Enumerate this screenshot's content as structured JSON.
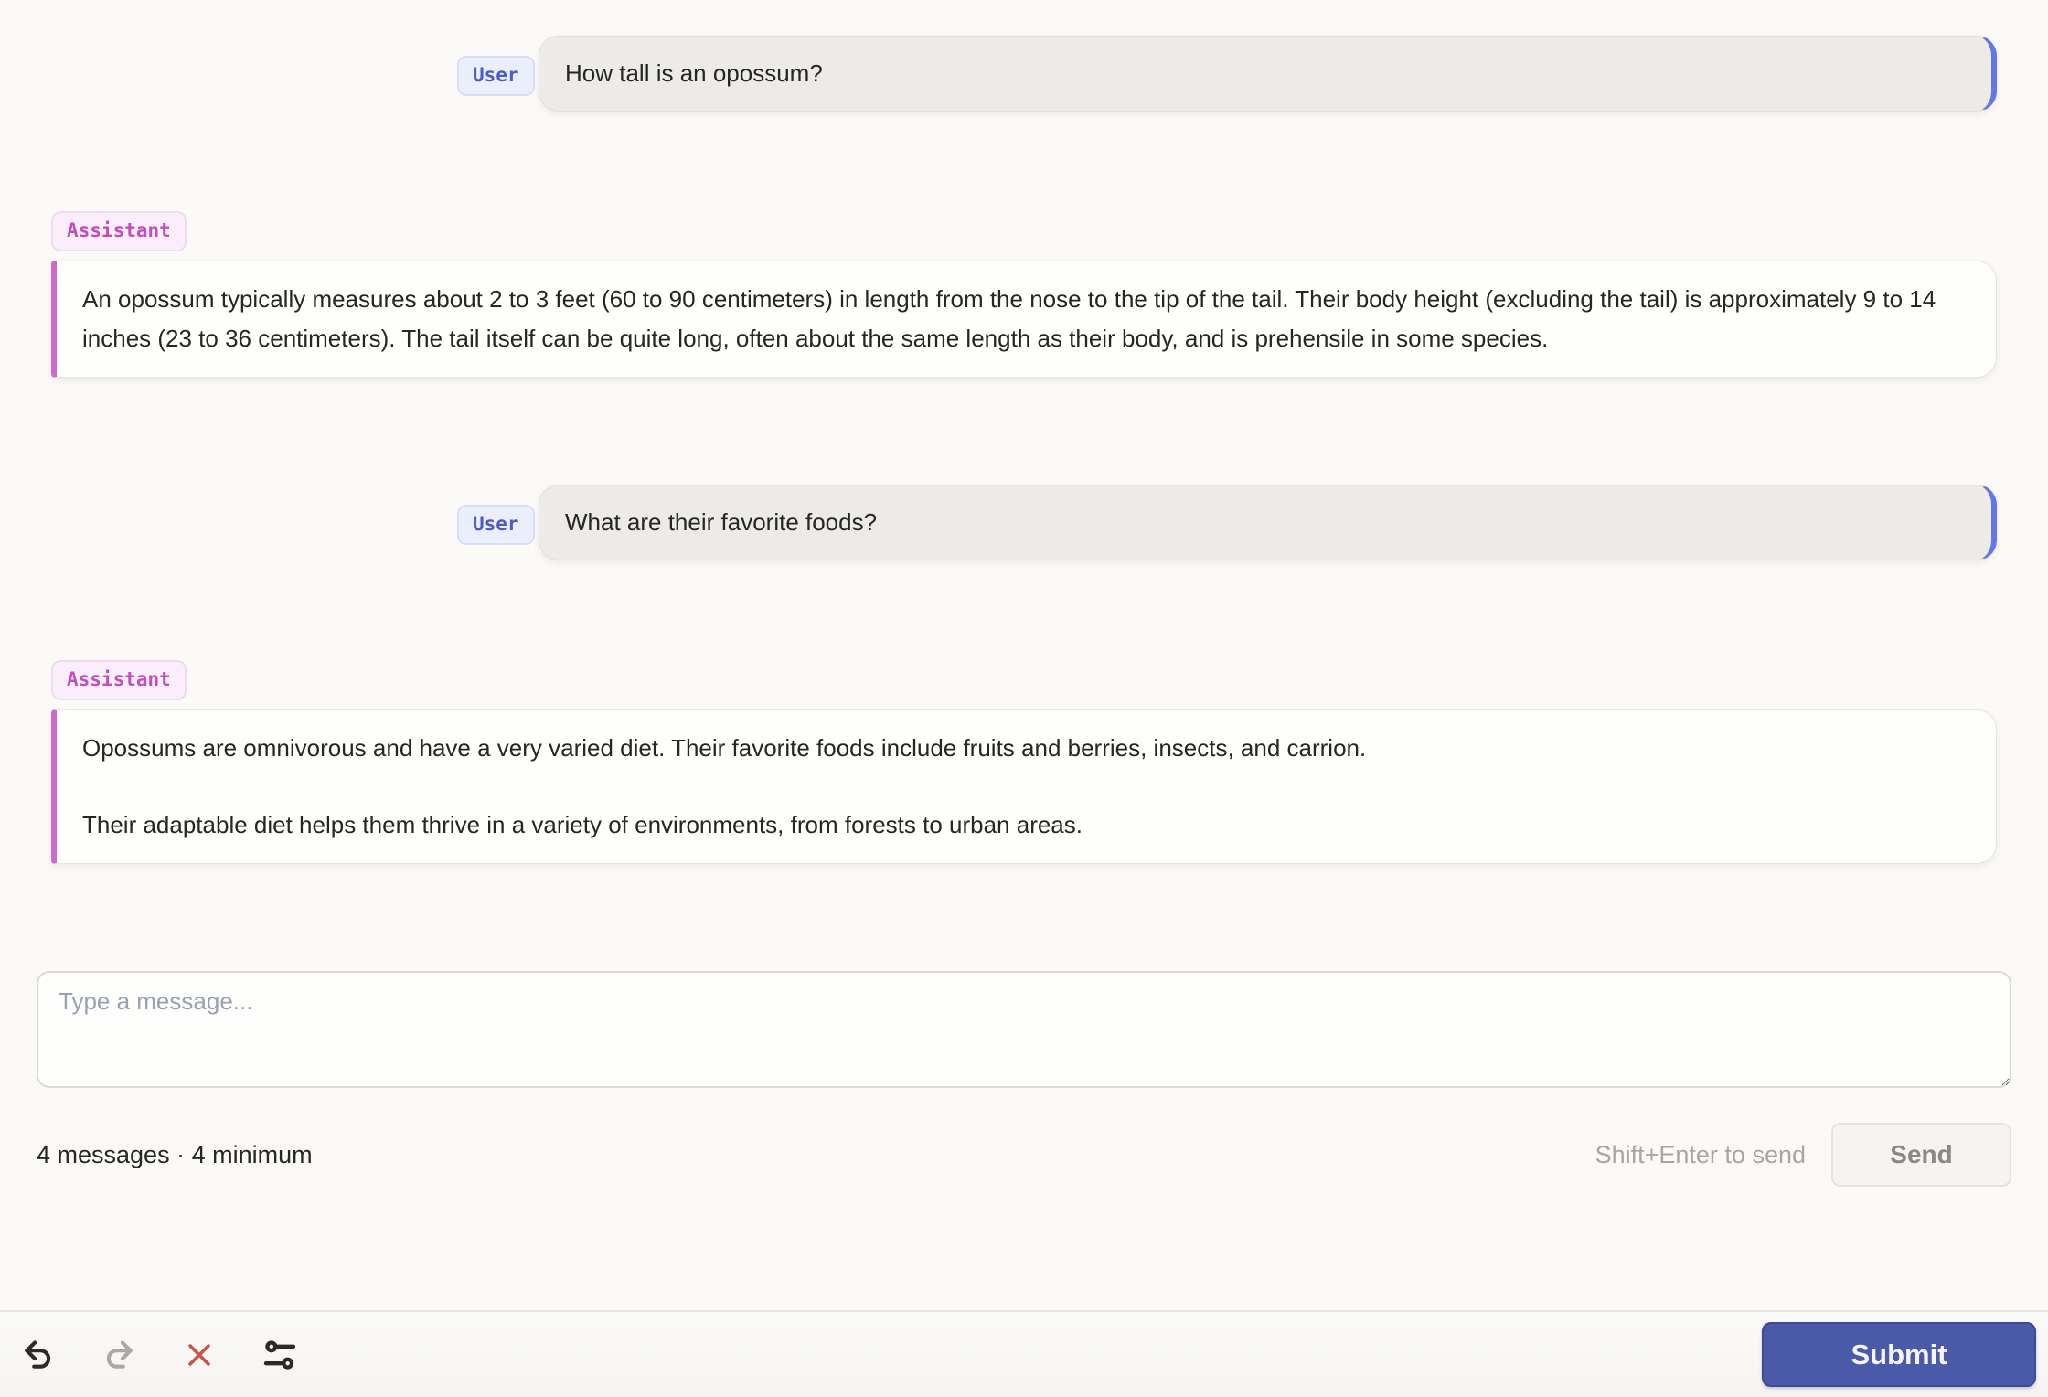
{
  "conversation": {
    "messages": [
      {
        "role_label": "User",
        "text": "How tall is an opossum?"
      },
      {
        "role_label": "Assistant",
        "text": "An opossum typically measures about 2 to 3 feet (60 to 90 centimeters) in length from the nose to the tip of the tail. Their body height (excluding the tail) is approximately 9 to 14 inches (23 to 36 centimeters). The tail itself can be quite long, often about the same length as their body, and is prehensile in some species."
      },
      {
        "role_label": "User",
        "text": "What are their favorite foods?"
      },
      {
        "role_label": "Assistant",
        "paragraphs": [
          "Opossums are omnivorous and have a very varied diet. Their favorite foods include fruits and berries, insects, and carrion.",
          "Their adaptable diet helps them thrive in a variety of environments, from forests to urban areas."
        ]
      }
    ]
  },
  "composer": {
    "placeholder": "Type a message...",
    "status_text": "4 messages · 4 minimum",
    "send_hint": "Shift+Enter to send",
    "send_label": "Send"
  },
  "toolbar": {
    "submit_label": "Submit",
    "icons": {
      "undo": "curved-arrow-left",
      "redo": "curved-arrow-right",
      "close": "red-x",
      "sliders": "tune-filters"
    }
  },
  "colors": {
    "user_accent": "#6377e8",
    "user_badge_text": "#4c5cc5",
    "assistant_accent": "#cf6aca",
    "assistant_badge_text": "#bf4fbe",
    "submit_bg": "#4a59a8",
    "close_icon": "#c4584a",
    "page_bg": "#fbfaf8"
  }
}
